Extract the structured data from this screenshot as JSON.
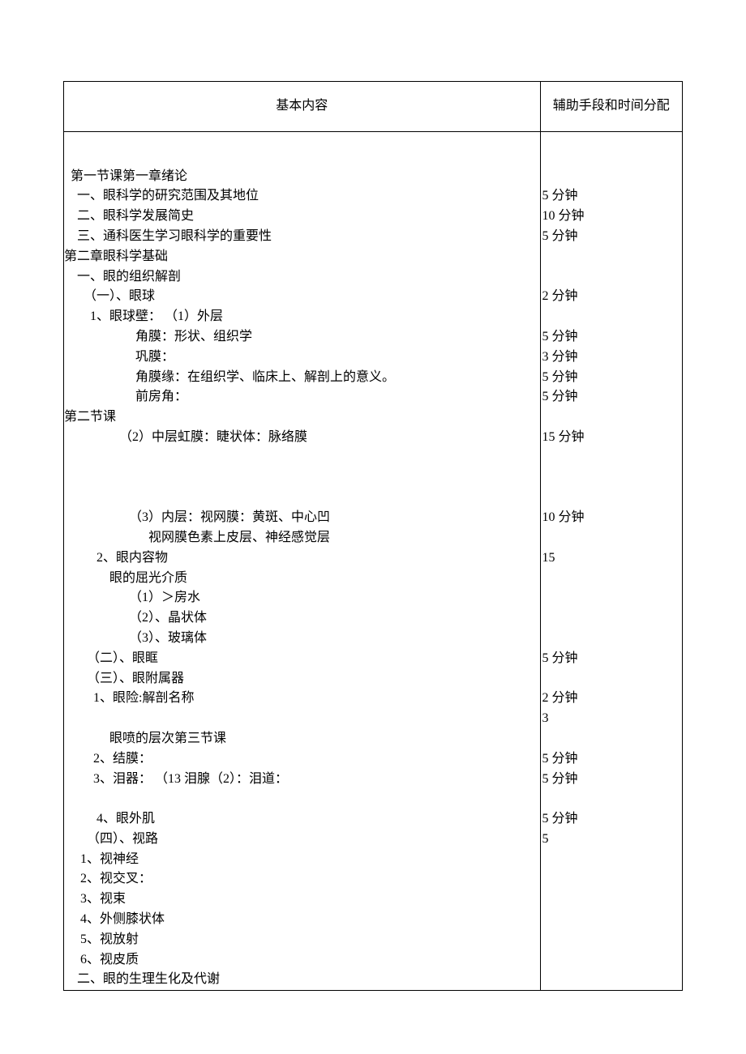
{
  "header": {
    "col1": "基本内容",
    "col2": "辅助手段和时间分配"
  },
  "rows": [
    {
      "c": "",
      "t": ""
    },
    {
      "c": "  第一节课第一章绪论",
      "t": ""
    },
    {
      "c": "    一、眼科学的研究范围及其地位",
      "t": "5 分钟"
    },
    {
      "c": "    二、眼科学发展简史",
      "t": "10 分钟"
    },
    {
      "c": "    三、通科医生学习眼科学的重要性",
      "t": "5 分钟"
    },
    {
      "c": "第二章眼科学基础",
      "t": ""
    },
    {
      "c": "    一、眼的组织解剖",
      "t": ""
    },
    {
      "c": "      （一）、眼球",
      "t": "2 分钟"
    },
    {
      "c": "        1、眼球壁： （1）外层",
      "t": ""
    },
    {
      "c": "                      角膜：形状、组织学",
      "t": "5 分钟"
    },
    {
      "c": "                      巩膜：",
      "t": "3 分钟"
    },
    {
      "c": "                      角膜缘：在组织学、临床上、解剖上的意义。",
      "t": "5 分钟"
    },
    {
      "c": "                      前房角：",
      "t": "5 分钟"
    },
    {
      "c": "第二节课",
      "t": ""
    },
    {
      "c": "                 （2）中层虹膜：睫状体：脉络膜",
      "t": "15 分钟"
    },
    {
      "c": "",
      "t": ""
    },
    {
      "c": "",
      "t": ""
    },
    {
      "c": "",
      "t": ""
    },
    {
      "c": "                    （3）内层：视网膜：黄斑、中心凹",
      "t": "10 分钟"
    },
    {
      "c": "                          视网膜色素上皮层、神经感觉层",
      "t": ""
    },
    {
      "c": "          2、眼内容物",
      "t": "15"
    },
    {
      "c": "              眼的屈光介质",
      "t": ""
    },
    {
      "c": "                    （1）＞房水",
      "t": ""
    },
    {
      "c": "                    （2）、晶状体",
      "t": ""
    },
    {
      "c": "                    （3）、玻璃体",
      "t": ""
    },
    {
      "c": "       （二）、眼眶",
      "t": "5 分钟"
    },
    {
      "c": "       （三）、眼附属器",
      "t": ""
    },
    {
      "c": "         1、眼险:解剖名称",
      "t": "2 分钟"
    },
    {
      "c": "",
      "t": "3"
    },
    {
      "c": "              眼喷的层次第三节课",
      "t": ""
    },
    {
      "c": "         2、结膜：",
      "t": "5 分钟"
    },
    {
      "c": "         3、泪器： （13 泪腺（2）：泪道：",
      "t": "5 分钟"
    },
    {
      "c": "",
      "t": ""
    },
    {
      "c": "          4、眼外肌",
      "t": "5 分钟"
    },
    {
      "c": "       （四）、视路",
      "t": "5"
    },
    {
      "c": "     1、视神经",
      "t": ""
    },
    {
      "c": "     2、视交叉：",
      "t": ""
    },
    {
      "c": "     3、视束",
      "t": ""
    },
    {
      "c": "     4、外侧膝状体",
      "t": ""
    },
    {
      "c": "     5、视放射",
      "t": ""
    },
    {
      "c": "     6、视皮质",
      "t": ""
    },
    {
      "c": "    二、眼的生理生化及代谢",
      "t": ""
    }
  ]
}
